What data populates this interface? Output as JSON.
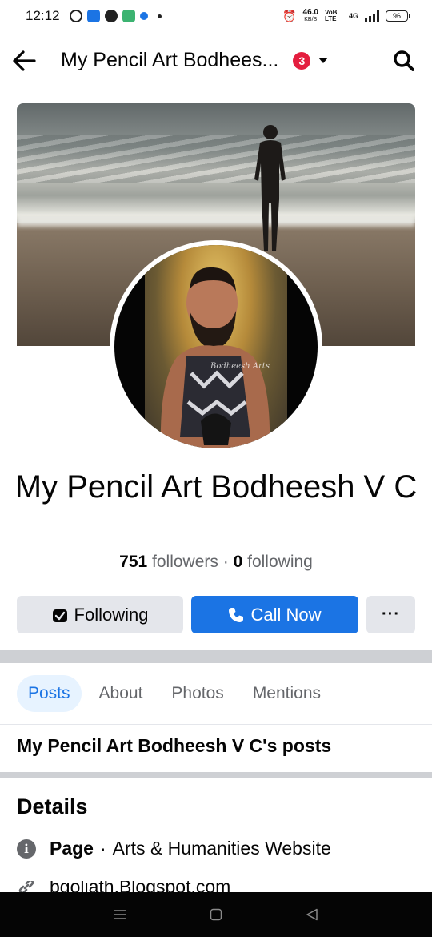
{
  "status_bar": {
    "time": "12:12",
    "net_speed": "46.0",
    "net_unit": "KB/S",
    "volte": "VoB LTE",
    "network": "4G",
    "battery": "96"
  },
  "app_bar": {
    "title": "My Pencil Art Bodhees...",
    "notification_count": "3"
  },
  "profile": {
    "name": "My Pencil Art Bodheesh V C",
    "followers_count": "751",
    "followers_label": "followers",
    "separator": "·",
    "following_count": "0",
    "following_label": "following",
    "avatar_signature": "Bodheesh Arts"
  },
  "actions": {
    "following_label": "Following",
    "call_label": "Call Now",
    "more_label": "···"
  },
  "tabs": [
    {
      "label": "Posts",
      "active": true
    },
    {
      "label": "About",
      "active": false
    },
    {
      "label": "Photos",
      "active": false
    },
    {
      "label": "Mentions",
      "active": false
    }
  ],
  "posts_section": {
    "title": "My Pencil Art Bodheesh V C's posts"
  },
  "details": {
    "title": "Details",
    "page_label": "Page",
    "separator": "·",
    "category": "Arts & Humanities Website",
    "website": "bgoliath.Blogspot.com"
  },
  "colors": {
    "accent": "#1b74e4",
    "badge": "#e41e3f",
    "tab_active_bg": "#e7f3ff",
    "button_gray": "#e4e6eb"
  }
}
